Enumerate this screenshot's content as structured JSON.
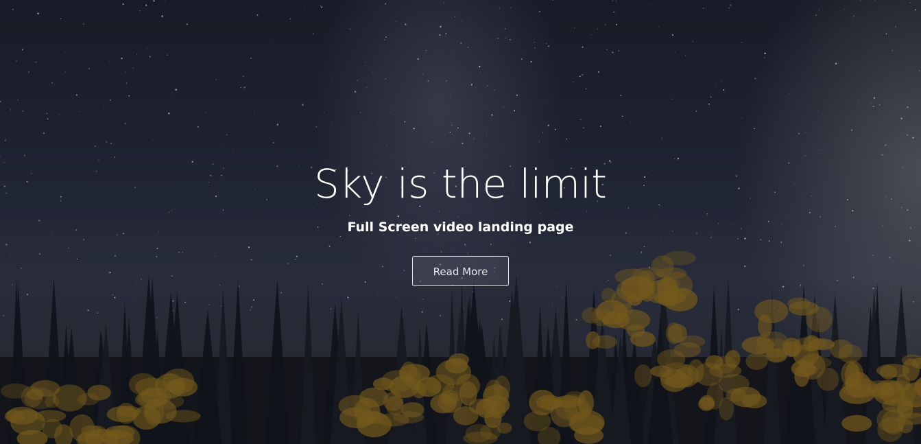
{
  "hero": {
    "title": "Sky is the limit",
    "subtitle": "Full Screen video landing page",
    "button_label": "Read More"
  },
  "colors": {
    "text": "#ffffff",
    "button_border": "#ffffff",
    "sky_top": "#1b1f2b",
    "forest_dark": "#12161c",
    "foliage_gold": "#8a6a1e"
  }
}
